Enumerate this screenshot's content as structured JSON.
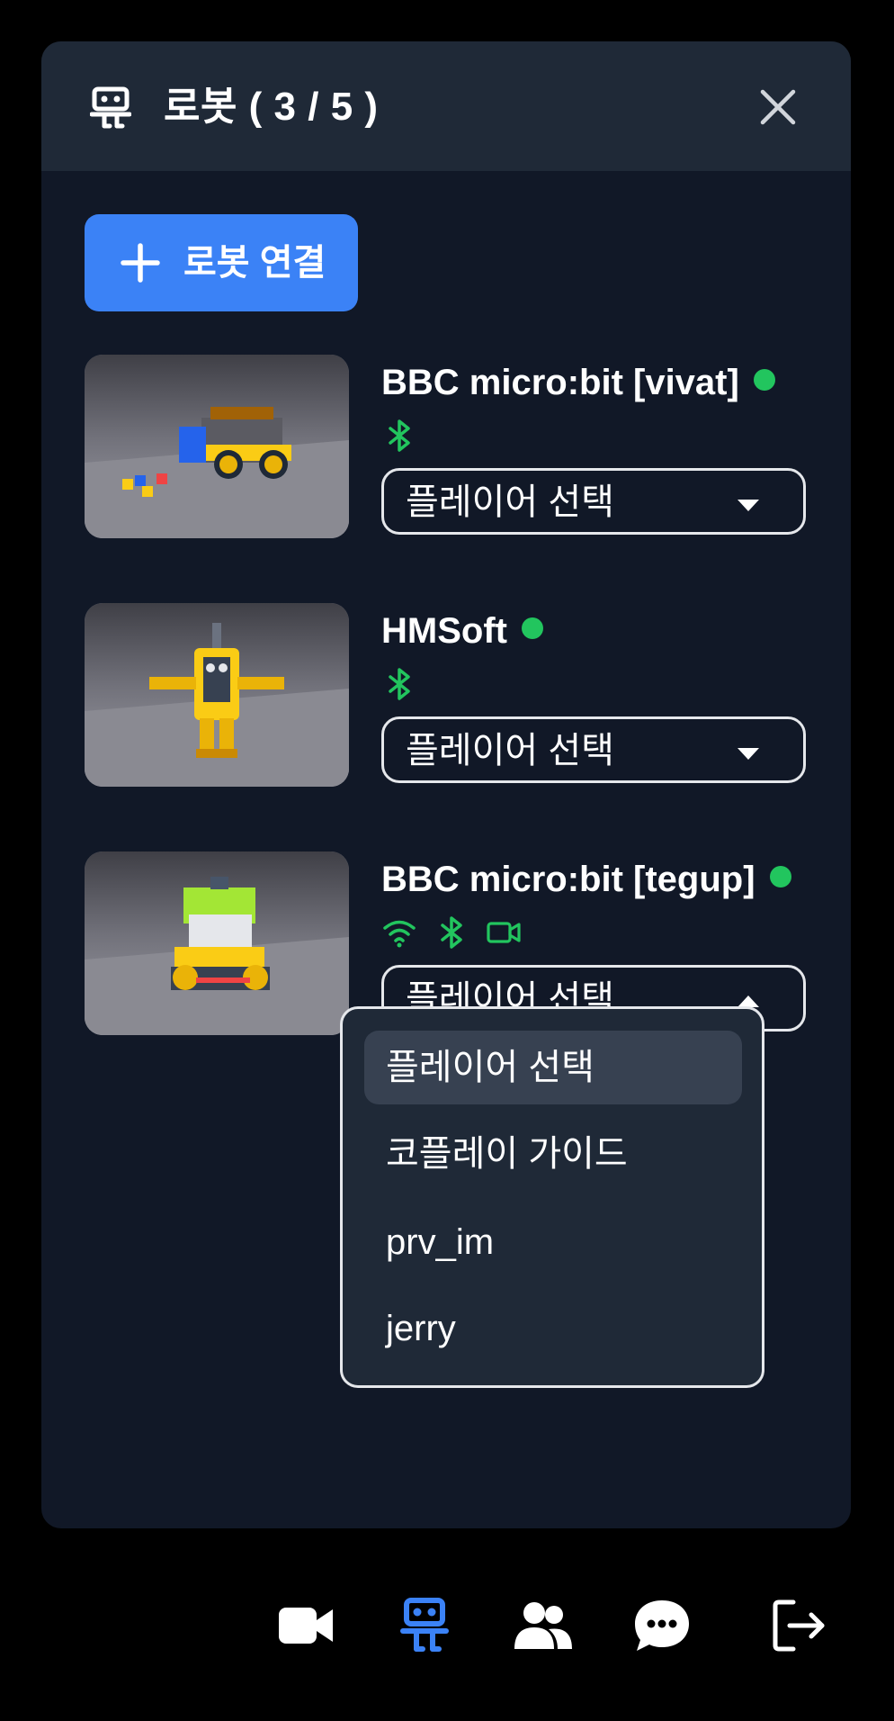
{
  "header": {
    "title": "로봇 ( 3 / 5 )",
    "icon": "robot-icon"
  },
  "connect_button": {
    "label": "로봇 연결",
    "icon": "plus-icon"
  },
  "robots": [
    {
      "name": "BBC micro:bit [vivat]",
      "status_color": "#22c55e",
      "icons": [
        "bluetooth-icon"
      ],
      "select_value": "플레이어 선택",
      "open": false
    },
    {
      "name": "HMSoft",
      "status_color": "#22c55e",
      "icons": [
        "bluetooth-icon"
      ],
      "select_value": "플레이어 선택",
      "open": false
    },
    {
      "name": "BBC micro:bit [tegup]",
      "status_color": "#22c55e",
      "icons": [
        "wifi-icon",
        "bluetooth-icon",
        "video-icon"
      ],
      "select_value": "플레이어 선택",
      "open": true
    }
  ],
  "dropdown": {
    "options": [
      "플레이어 선택",
      "코플레이 가이드",
      "prv_im",
      "jerry"
    ],
    "selected": "플레이어 선택"
  },
  "bottom_nav": [
    {
      "icon": "video-icon",
      "active": false
    },
    {
      "icon": "robot-icon",
      "active": true
    },
    {
      "icon": "users-icon",
      "active": false
    },
    {
      "icon": "chat-icon",
      "active": false
    },
    {
      "icon": "logout-icon",
      "active": false
    }
  ],
  "colors": {
    "accent": "#3b82f6",
    "online": "#22c55e",
    "panel": "#111827",
    "header": "#1f2937"
  }
}
